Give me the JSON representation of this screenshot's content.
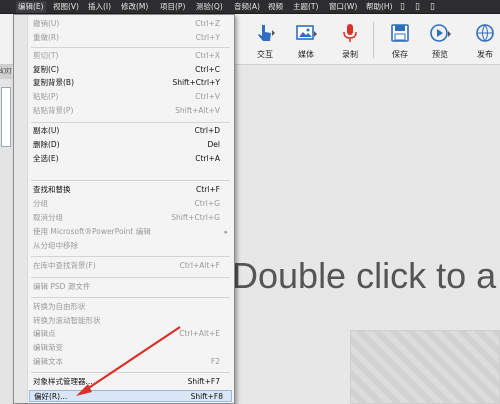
{
  "menubar": {
    "items": [
      "编辑(E)",
      "视图(V)",
      "插入(I)",
      "修改(M)",
      "项目(P)",
      "测验(Q)",
      "音频(A)",
      "视频",
      "主题(T)",
      "窗口(W)",
      "帮助(H)"
    ]
  },
  "toolbar": {
    "buttons": [
      {
        "label": "交互",
        "icon": "interaction-icon"
      },
      {
        "label": "媒体",
        "icon": "media-icon"
      },
      {
        "label": "录制",
        "icon": "microphone-icon"
      },
      {
        "label": "保存",
        "icon": "save-icon"
      },
      {
        "label": "预览",
        "icon": "preview-icon"
      },
      {
        "label": "发布",
        "icon": "publish-icon"
      }
    ]
  },
  "left_pane": {
    "tab_label": "幻灯"
  },
  "stage": {
    "canvas_text": "Double click to a"
  },
  "edit_menu": {
    "items": [
      {
        "label": "撤销(U)",
        "shortcut": "Ctrl+Z",
        "disabled": true
      },
      {
        "label": "重做(R)",
        "shortcut": "Ctrl+Y",
        "disabled": true
      },
      {
        "label": "剪切(T)",
        "shortcut": "Ctrl+X",
        "disabled": true
      },
      {
        "label": "复制(C)",
        "shortcut": "Ctrl+C",
        "disabled": false
      },
      {
        "label": "复制背景(B)",
        "shortcut": "Shift+Ctrl+Y",
        "disabled": false
      },
      {
        "label": "粘贴(P)",
        "shortcut": "Ctrl+V",
        "disabled": true
      },
      {
        "label": "粘贴背景(P)",
        "shortcut": "Shift+Alt+V",
        "disabled": true
      },
      {
        "label": "副本(U)",
        "shortcut": "Ctrl+D",
        "disabled": false
      },
      {
        "label": "删除(D)",
        "shortcut": "Del",
        "disabled": false
      },
      {
        "label": "全选(E)",
        "shortcut": "Ctrl+A",
        "disabled": false
      },
      {
        "label": "查找和替换",
        "shortcut": "Ctrl+F",
        "disabled": false
      },
      {
        "label": "分组",
        "shortcut": "Ctrl+G",
        "disabled": true
      },
      {
        "label": "取消分组",
        "shortcut": "Shift+Ctrl+G",
        "disabled": true
      },
      {
        "label": "使用 Microsoft®PowerPoint 编辑",
        "shortcut": "",
        "disabled": true,
        "submenu": true
      },
      {
        "label": "从分组中移除",
        "shortcut": "",
        "disabled": true
      },
      {
        "label": "在库中查找背景(F)",
        "shortcut": "Ctrl+Alt+F",
        "disabled": true
      },
      {
        "label": "编辑 PSD 源文件",
        "shortcut": "",
        "disabled": true
      },
      {
        "label": "转换为自由形状",
        "shortcut": "",
        "disabled": true
      },
      {
        "label": "转换为滚动智能形状",
        "shortcut": "",
        "disabled": true
      },
      {
        "label": "编辑点",
        "shortcut": "Ctrl+Alt+E",
        "disabled": true
      },
      {
        "label": "编辑渐变",
        "shortcut": "",
        "disabled": true
      },
      {
        "label": "编辑文本",
        "shortcut": "F2",
        "disabled": true
      },
      {
        "label": "对象样式管理器...",
        "shortcut": "Shift+F7",
        "disabled": false
      },
      {
        "label": "偏好(R)...",
        "shortcut": "Shift+F8",
        "disabled": false
      }
    ]
  },
  "colors": {
    "annotation_arrow": "#d9302a",
    "microphone": "#d9302a"
  }
}
